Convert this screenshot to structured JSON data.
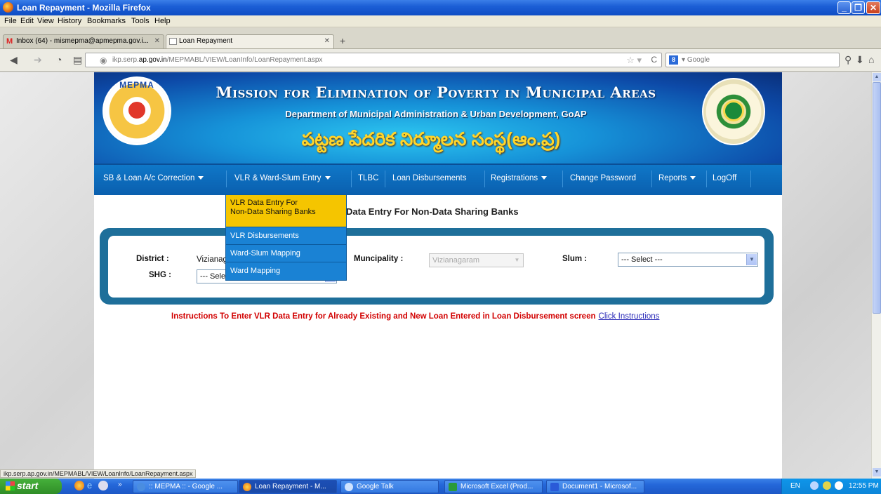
{
  "window": {
    "title": "Loan Repayment - Mozilla Firefox"
  },
  "menubar": {
    "items": [
      "File",
      "Edit",
      "View",
      "History",
      "Bookmarks",
      "Tools",
      "Help"
    ]
  },
  "tabs": [
    {
      "label": "Inbox (64) - mismepma@apmepma.gov.i...",
      "active": false
    },
    {
      "label": "Loan Repayment",
      "active": true
    }
  ],
  "navbar": {
    "url_prefix": "ikp.serp.",
    "url_domain": "ap.gov.in",
    "url_path": "/MEPMABL/VIEW/LoanInfo/LoanRepayment.aspx",
    "search_placeholder": "Google"
  },
  "banner": {
    "logo_text": "MEPMA",
    "title": "Mission for Elimination of Poverty in Municipal Areas",
    "subtitle": "Department of Municipal Administration & Urban Development, GoAP",
    "telugu": "పట్టణ పేదరిక నిర్మూలన సంస్థ(ఆం.ప్ర)"
  },
  "nav": {
    "items": [
      {
        "label": "SB & Loan A/c Correction",
        "dropdown": true
      },
      {
        "label": "VLR & Ward-Slum Entry",
        "dropdown": true
      },
      {
        "label": "TLBC",
        "dropdown": false
      },
      {
        "label": "Loan Disbursements",
        "dropdown": false
      },
      {
        "label": "Registrations",
        "dropdown": true
      },
      {
        "label": "Change Password",
        "dropdown": false
      },
      {
        "label": "Reports",
        "dropdown": true
      },
      {
        "label": "LogOff",
        "dropdown": false
      }
    ]
  },
  "dropdown": {
    "items": [
      {
        "line1": "VLR Data Entry For",
        "line2": "Non-Data Sharing Banks"
      },
      {
        "line1": "VLR Disbursements"
      },
      {
        "line1": "Ward-Slum Mapping"
      },
      {
        "line1": "Ward Mapping"
      }
    ]
  },
  "page": {
    "heading": "Data Entry For Non-Data Sharing Banks"
  },
  "form": {
    "district_label": "District :",
    "district_value": "Vizianagaram",
    "municipality_label": "Muncipality :",
    "municipality_value": "Vizianagaram",
    "slum_label": "Slum :",
    "slum_value": "--- Select ---",
    "shg_label": "SHG :",
    "shg_value": "--- Select ---"
  },
  "instructions": {
    "text": "Instructions To Enter VLR Data Entry for Already Existing and New Loan Entered in Loan Disbursement screen",
    "link": "Click Instructions"
  },
  "status_url": "ikp.serp.ap.gov.in/MEPMABL/VIEW/LoanInfo/LoanRepayment.aspx",
  "taskbar": {
    "start": "start",
    "items": [
      {
        "label": ":: MEPMA :: - Google ...",
        "active": false
      },
      {
        "label": "Loan Repayment - M...",
        "active": true
      },
      {
        "label": "Google Talk",
        "active": false
      },
      {
        "label": "Microsoft Excel (Prod...",
        "active": false
      },
      {
        "label": "Document1 - Microsof...",
        "active": false
      }
    ],
    "lang": "EN",
    "clock": "12:55 PM"
  }
}
